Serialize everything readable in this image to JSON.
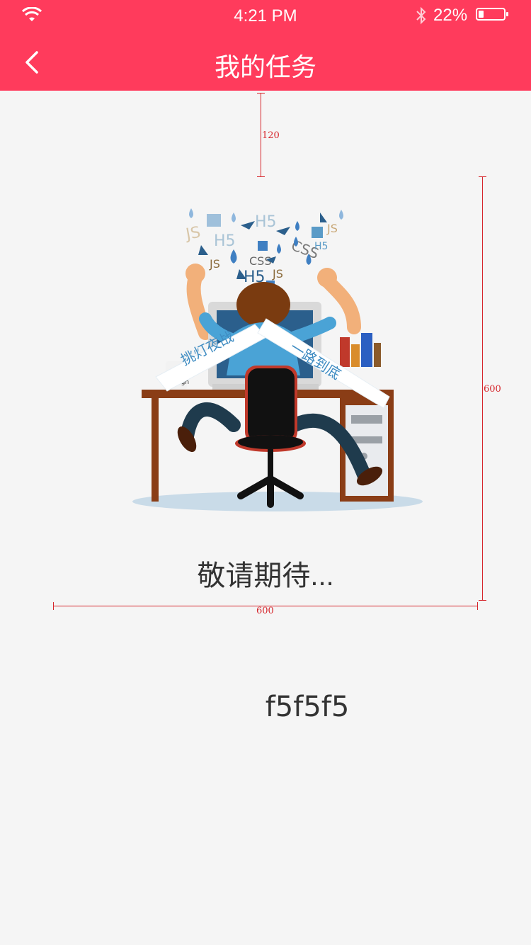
{
  "status_bar": {
    "time": "4:21 PM",
    "battery_percent": "22%",
    "battery_level": 0.22,
    "icons": [
      "wifi-icon",
      "bluetooth-icon",
      "battery-icon"
    ]
  },
  "nav": {
    "title": "我的任务",
    "back_icon": "chevron-left-icon"
  },
  "annotations": {
    "top_gap": "120",
    "height": "600",
    "width": "600"
  },
  "illustration": {
    "banner_left": "挑灯夜战",
    "banner_right": "一路到底",
    "mug_text": "Design",
    "tech_labels": [
      "JS",
      "H5",
      "H5",
      "CSS",
      "H5",
      "JS",
      "JS",
      "CSS",
      "JS",
      "H5",
      "H5"
    ]
  },
  "message": "敬请期待...",
  "background_color_label": "f5f5f5",
  "colors": {
    "accent": "#ff3b5c",
    "background": "#f5f5f5",
    "annotation": "#d6262c"
  }
}
